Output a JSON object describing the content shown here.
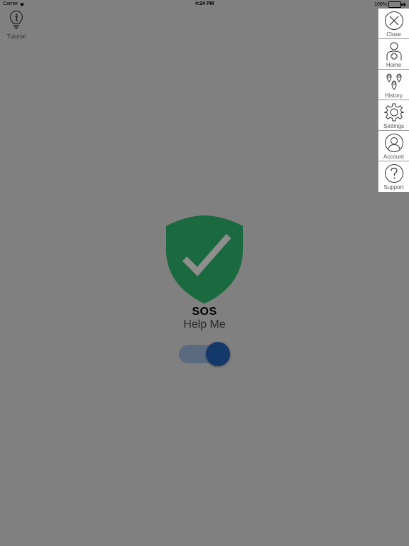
{
  "status_bar": {
    "carrier": "Carrier",
    "time": "4:24 PM",
    "battery": "100%"
  },
  "tutorial": {
    "label": "Tutorial"
  },
  "side_nav": {
    "items": [
      {
        "label": "Close",
        "icon": "close-icon"
      },
      {
        "label": "Home",
        "icon": "home-icon"
      },
      {
        "label": "History",
        "icon": "history-icon"
      },
      {
        "label": "Settings",
        "icon": "gear-icon"
      },
      {
        "label": "Account",
        "icon": "account-icon"
      },
      {
        "label": "Support",
        "icon": "question-icon"
      }
    ]
  },
  "main": {
    "title": "SOS",
    "subtitle": "Help Me",
    "toggle_on": true
  },
  "colors": {
    "background": "#808080",
    "shield": "#1b6a3f",
    "toggle_track": "#5b6b7f",
    "toggle_knob": "#13386a"
  }
}
